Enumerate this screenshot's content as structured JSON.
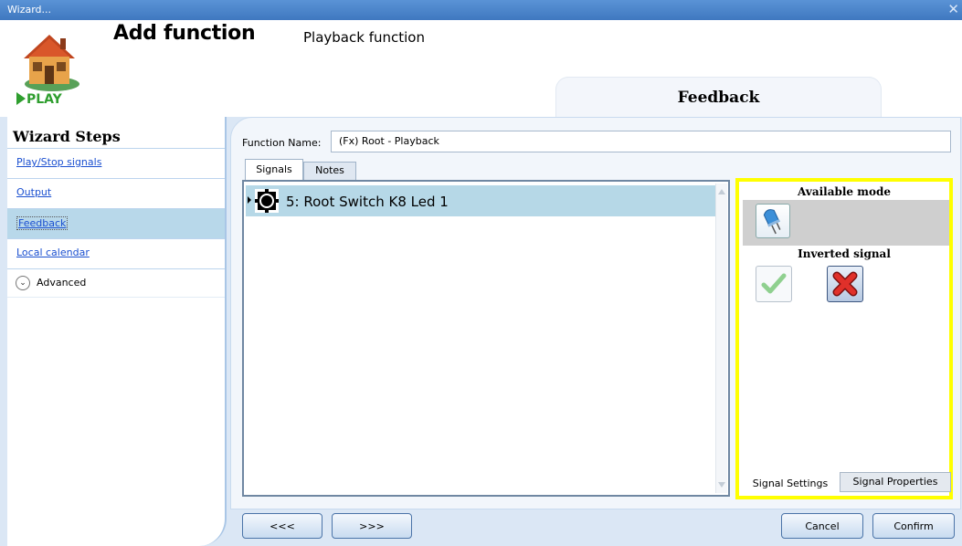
{
  "window": {
    "title": "Wizard...",
    "close_glyph": "✕"
  },
  "header": {
    "title": "Add function",
    "subtitle": "Playback function",
    "logo_text": "PLAY",
    "current_step": "Feedback"
  },
  "sidebar": {
    "title": "Wizard Steps",
    "items": [
      {
        "label": "Play/Stop signals",
        "active": false
      },
      {
        "label": "Output",
        "active": false
      },
      {
        "label": "Feedback",
        "active": true
      },
      {
        "label": "Local calendar",
        "active": false
      }
    ],
    "advanced_label": "Advanced"
  },
  "main": {
    "function_name_label": "Function Name:",
    "function_name_value": "(Fx) Root - Playback",
    "tabs": [
      {
        "label": "Signals",
        "selected": true
      },
      {
        "label": "Notes",
        "selected": false
      }
    ],
    "signals": [
      {
        "label": "5: Root Switch K8 Led 1"
      }
    ]
  },
  "side_panel": {
    "available_mode_title": "Available mode",
    "inverted_signal_title": "Inverted signal",
    "tabs": [
      {
        "label": "Signal Settings"
      },
      {
        "label": "Signal Properties"
      }
    ]
  },
  "footer": {
    "prev_label": "<<<",
    "next_label": ">>>",
    "cancel_label": "Cancel",
    "confirm_label": "Confirm"
  },
  "colors": {
    "titlebar": "#4a86cc",
    "highlight_border": "#ffff00",
    "selected_row": "#b6d8e7",
    "logo_green": "#2f9e2f"
  },
  "icons": {
    "logo": "house-icon",
    "signal": "signal-led-icon",
    "mode": "led-icon",
    "inverted_yes": "checkmark-icon",
    "inverted_no": "red-x-icon"
  }
}
